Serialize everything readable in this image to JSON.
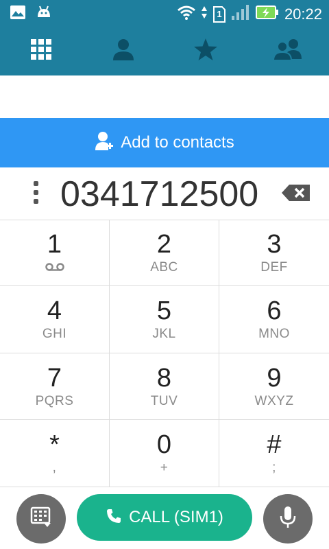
{
  "status_bar": {
    "time": "20:22",
    "sim_slot": "1",
    "icons": [
      "gallery-icon",
      "android-icon",
      "wifi-icon",
      "sim-icon",
      "signal-icon",
      "battery-charging-icon"
    ]
  },
  "tabs": [
    {
      "name": "dialpad-tab",
      "icon": "dialpad-icon"
    },
    {
      "name": "contacts-tab",
      "icon": "person-icon"
    },
    {
      "name": "favorites-tab",
      "icon": "star-icon"
    },
    {
      "name": "groups-tab",
      "icon": "group-icon"
    }
  ],
  "add_to_contacts": {
    "label": "Add to contacts"
  },
  "dialer": {
    "number": "0341712500"
  },
  "keys": [
    {
      "digit": "1",
      "letters": ""
    },
    {
      "digit": "2",
      "letters": "ABC"
    },
    {
      "digit": "3",
      "letters": "DEF"
    },
    {
      "digit": "4",
      "letters": "GHI"
    },
    {
      "digit": "5",
      "letters": "JKL"
    },
    {
      "digit": "6",
      "letters": "MNO"
    },
    {
      "digit": "7",
      "letters": "PQRS"
    },
    {
      "digit": "8",
      "letters": "TUV"
    },
    {
      "digit": "9",
      "letters": "WXYZ"
    },
    {
      "digit": "*",
      "letters": ","
    },
    {
      "digit": "0",
      "letters": "+"
    },
    {
      "digit": "#",
      "letters": ";"
    }
  ],
  "call_button": {
    "label": "CALL (SIM1)"
  },
  "colors": {
    "header": "#1e7f9e",
    "add_bar": "#2f97f4",
    "call": "#1ab38d",
    "round_button": "#6b6b6b"
  }
}
